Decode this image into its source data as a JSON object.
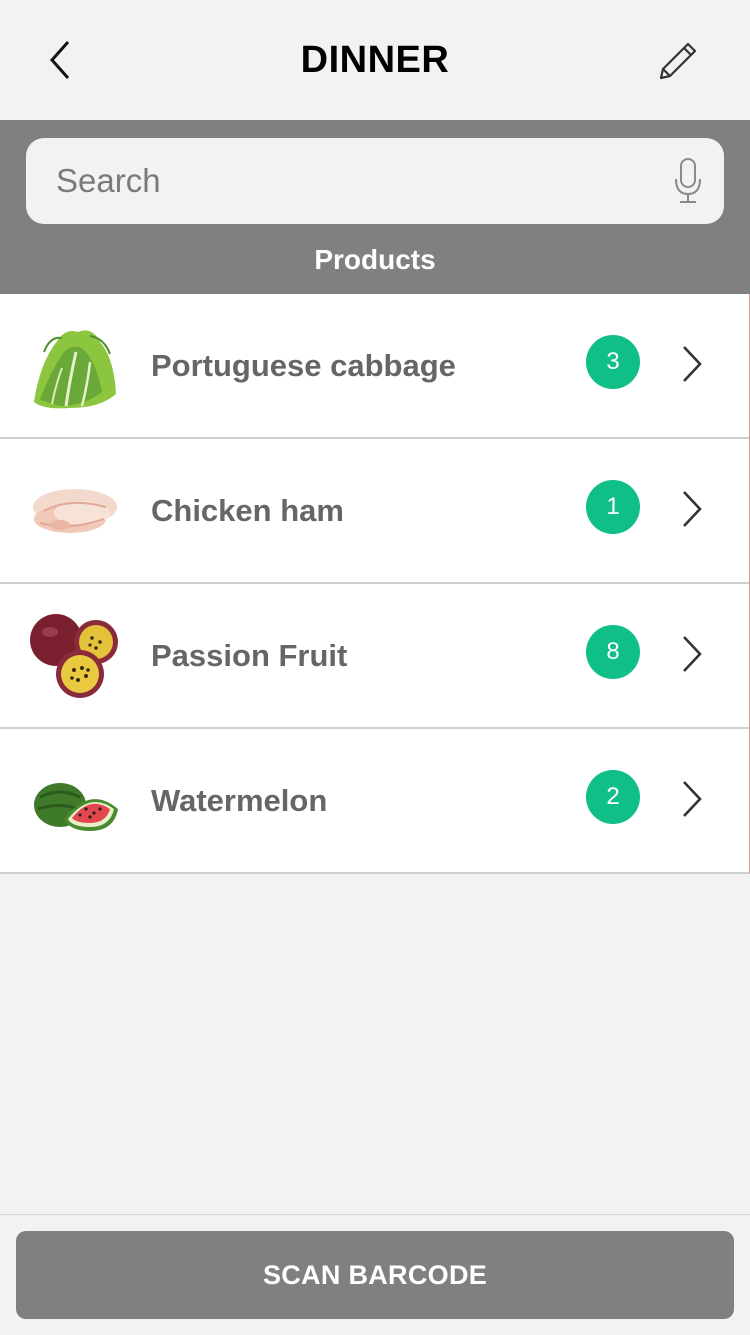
{
  "header": {
    "title": "DINNER",
    "back_icon": "chevron-left-icon",
    "edit_icon": "pencil-icon"
  },
  "search": {
    "placeholder": "Search",
    "value": "",
    "mic_icon": "microphone-icon"
  },
  "section": {
    "label": "Products"
  },
  "products": [
    {
      "name": "Portuguese cabbage",
      "count": "3",
      "image": "cabbage-image"
    },
    {
      "name": "Chicken ham",
      "count": "1",
      "image": "ham-slices-image"
    },
    {
      "name": "Passion Fruit",
      "count": "8",
      "image": "passion-fruit-image"
    },
    {
      "name": "Watermelon",
      "count": "2",
      "image": "watermelon-image"
    }
  ],
  "footer": {
    "scan_label": "SCAN BARCODE"
  },
  "colors": {
    "accent_badge": "#10bf87",
    "band_gray": "#808080",
    "background": "#f2f2f2",
    "product_text": "#666666"
  }
}
